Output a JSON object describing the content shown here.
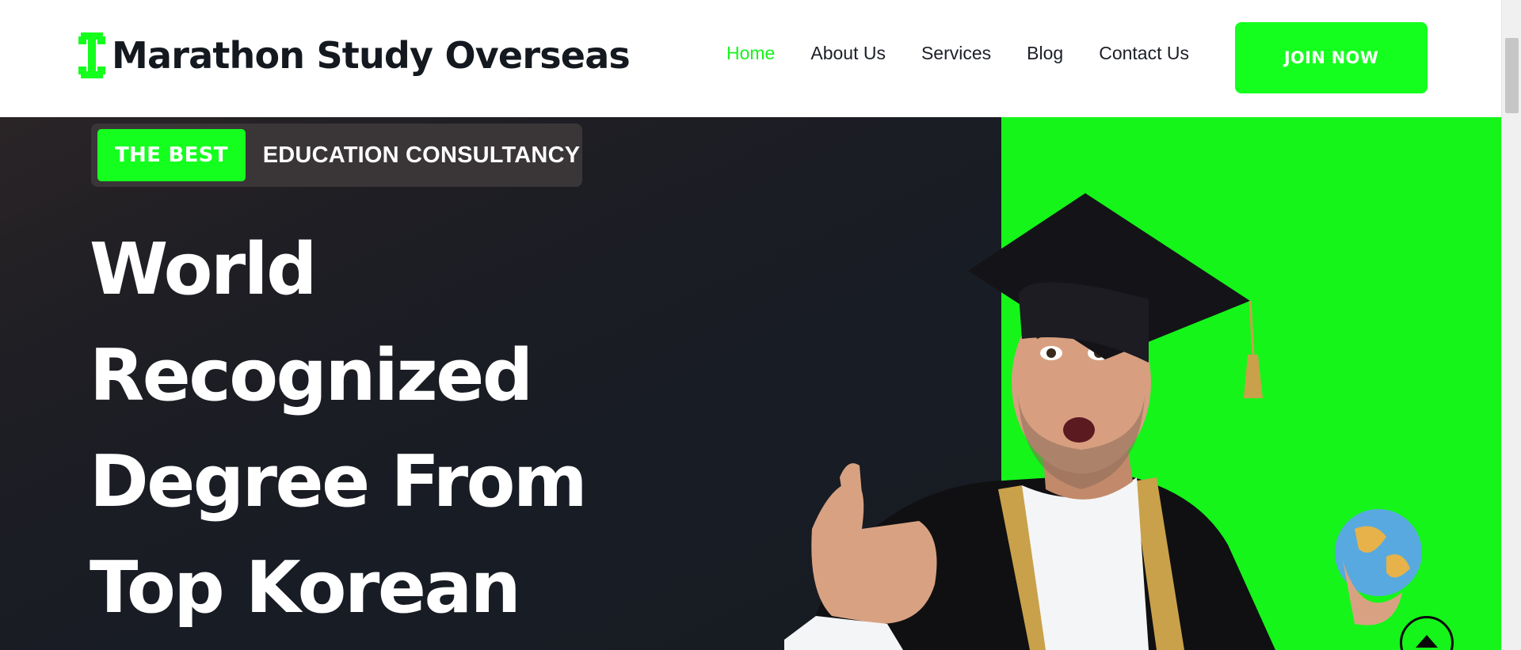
{
  "header": {
    "logo": {
      "text": "Marathon Study Overseas",
      "icon": "green-dumbbell-icon",
      "color": "#15ff1e"
    },
    "nav": [
      {
        "label": "Home",
        "active": true
      },
      {
        "label": "About Us",
        "active": false
      },
      {
        "label": "Services",
        "active": false
      },
      {
        "label": "Blog",
        "active": false
      },
      {
        "label": "Contact Us",
        "active": false
      }
    ],
    "cta_label": "JOIN NOW"
  },
  "hero": {
    "badge_highlight": "THE BEST",
    "badge_text": "EDUCATION CONSULTANCY",
    "heading_lines": [
      "World",
      "Recognized",
      "Degree From",
      "Top Korean"
    ],
    "image": "graduate-thumbs-up-with-globe"
  },
  "colors": {
    "accent_green": "#15ff1e",
    "nav_active": "#15f51a",
    "hero_dark": "#181c24",
    "text_dark": "#14181f"
  },
  "icons": {
    "scroll_top": "arrow-up-icon"
  }
}
